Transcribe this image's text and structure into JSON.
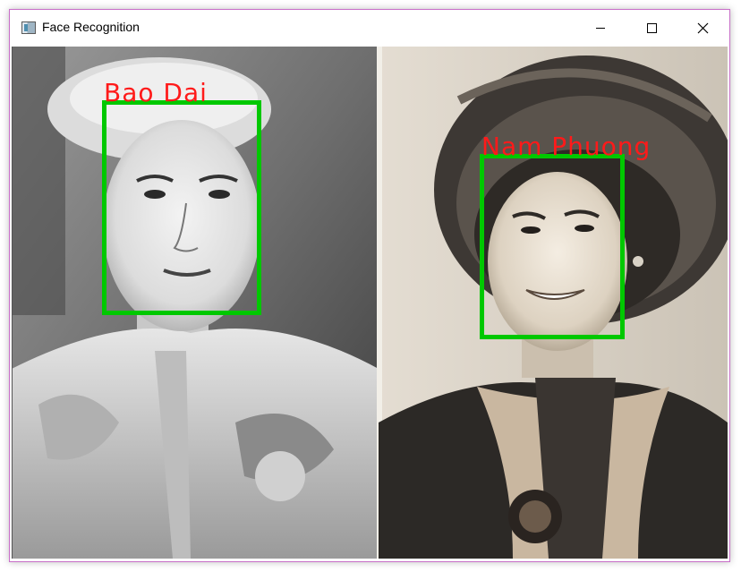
{
  "window": {
    "title": "Face Recognition",
    "icon": "app-window-icon",
    "controls": [
      "minimize-icon",
      "maximize-icon",
      "close-icon"
    ]
  },
  "image": {
    "faces": [
      {
        "label": "Bao Dai"
      },
      {
        "label": "Nam Phuong"
      }
    ],
    "colors": {
      "box": "#00c800",
      "label": "#ff1a1a",
      "border": "#c86ec8"
    }
  }
}
